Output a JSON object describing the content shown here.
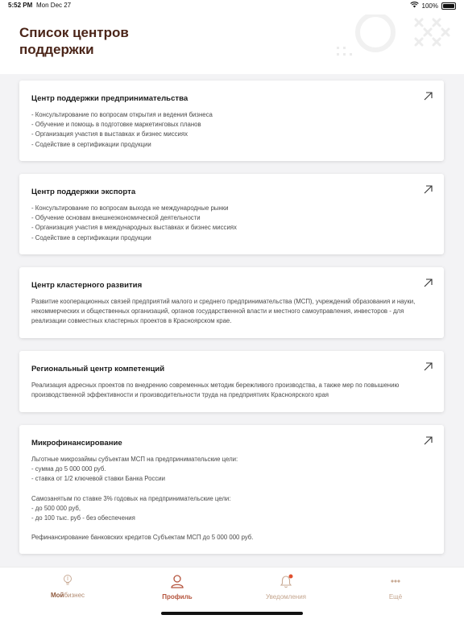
{
  "status_bar": {
    "time": "5:52 PM",
    "date": "Mon Dec 27",
    "battery": "100%"
  },
  "header": {
    "title": "Список центров поддержки"
  },
  "cards": [
    {
      "title": "Центр поддержки предпринимательства",
      "lines": [
        "- Консультирование по вопросам открытия и ведения бизнеса",
        "- Обучение и помощь в подготовке маркетинговых планов",
        "- Организация участия в выставках и бизнес миссиях",
        "- Содействие в сертификации продукции"
      ]
    },
    {
      "title": "Центр поддержки экспорта",
      "lines": [
        "- Консультирование по вопросам выхода не международные рынки",
        "- Обучение основам внешнеэкономической деятельности",
        "- Организация участия в международных выставках и бизнес миссиях",
        "- Содействие в сертификации продукции"
      ]
    },
    {
      "title": "Центр кластерного развития",
      "text": "Развитие кооперационных связей предприятий малого и среднего предпринимательства (МСП), учреждений образования и науки, некоммерческих и общественных организаций, органов государственной власти и местного самоуправления, инвесторов - для реализации совместных кластерных проектов в Красноярском крае."
    },
    {
      "title": "Региональный центр компетенций",
      "text": "Реализация адресных проектов по внедрению современных методик бережливого производства, а также мер по повышению производственной эффективности и производительности труда на предприятиях Красноярского края"
    },
    {
      "title": "Микрофинансирование",
      "lines": [
        "Льготные микрозаймы субъектам МСП на предпринимательские цели:",
        "- сумма до 5 000 000 руб.",
        "- ставка от 1/2 ключевой ставки Банка России",
        "",
        "Самозанятым по ставке 3% годовых на предпринимательские цели:",
        "- до 500 000 руб,",
        "- до 100 тыс. руб - без обеспечения",
        "",
        "Рефинансирование банковских кредитов Субъектам МСП до 5 000 000 руб."
      ]
    }
  ],
  "tabbar": {
    "tabs": [
      {
        "label_bold": "Мой",
        "label_thin": "бизнес",
        "icon": "lightbulb-icon"
      },
      {
        "label": "Профиль",
        "icon": "profile-icon",
        "active": true
      },
      {
        "label": "Уведомления",
        "icon": "bell-icon",
        "badge": true
      },
      {
        "label": "Ещё",
        "icon": "more-icon"
      }
    ]
  },
  "colors": {
    "title": "#4a2418",
    "accent": "#b5543d",
    "tab_inactive": "#c4a58e",
    "badge": "#e0502f"
  }
}
